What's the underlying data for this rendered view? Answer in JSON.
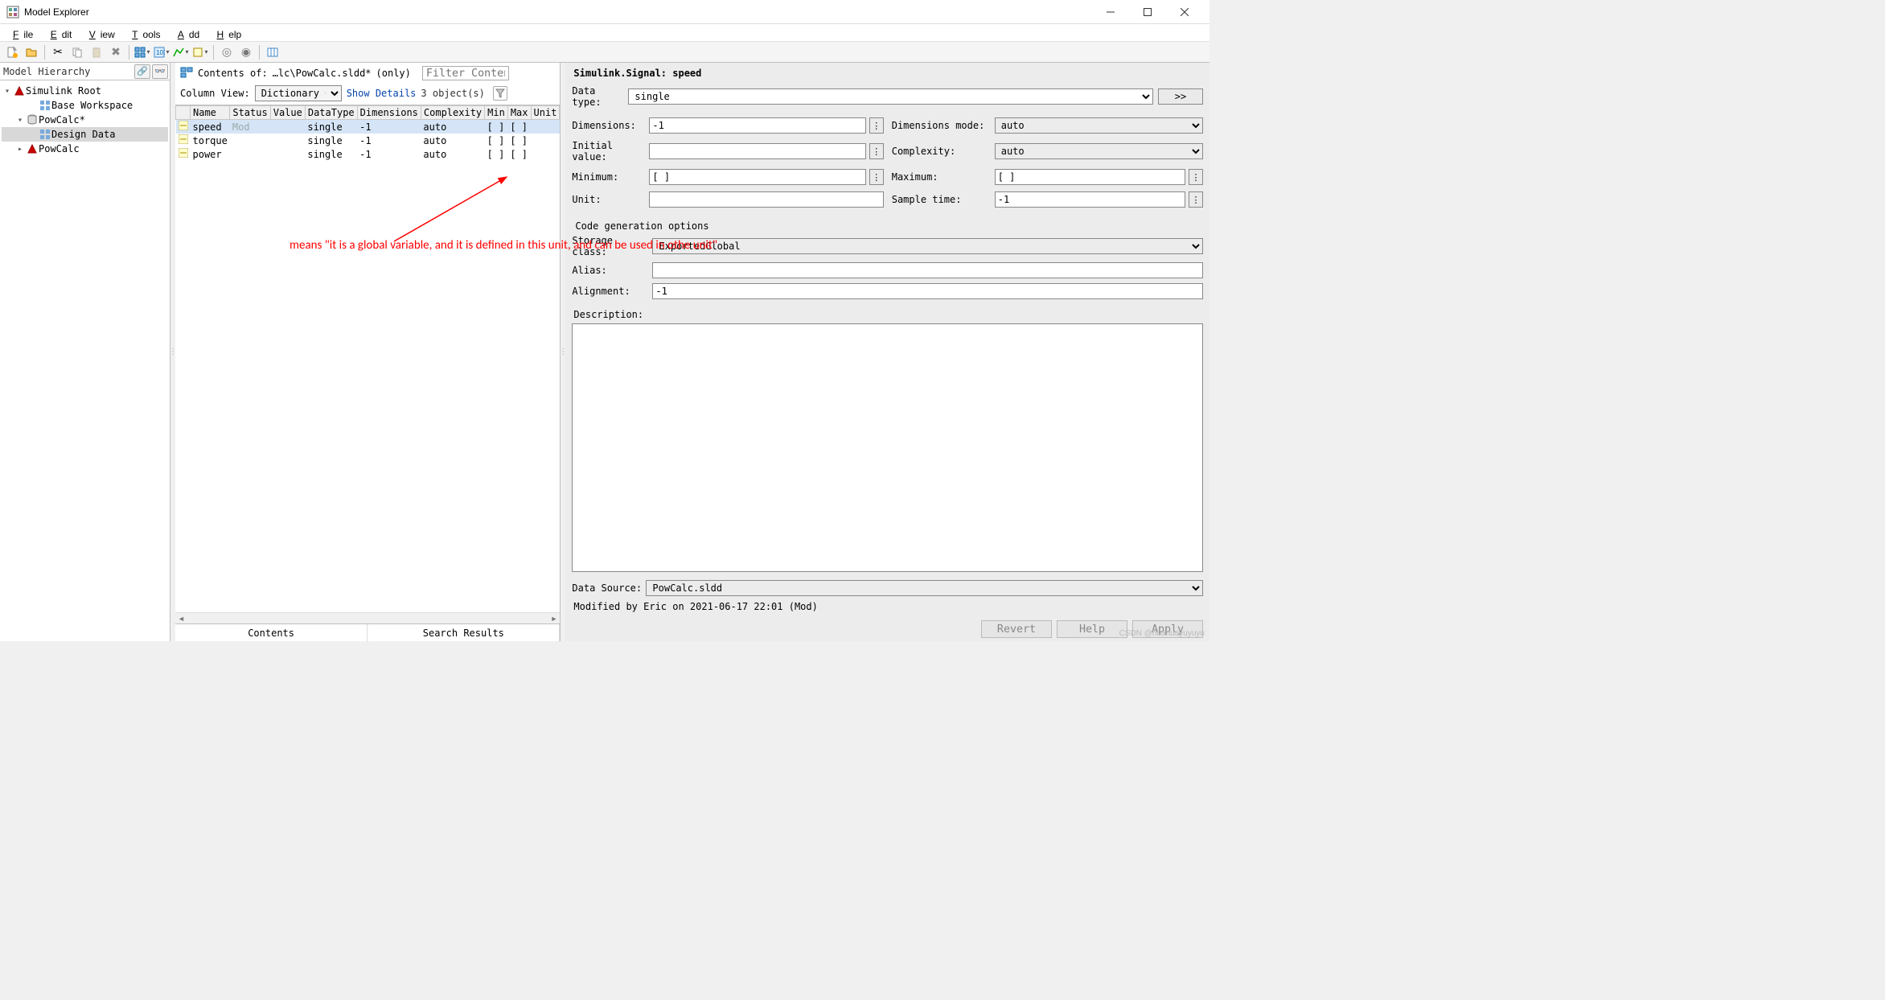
{
  "window": {
    "title": "Model Explorer"
  },
  "menu": {
    "file": "File",
    "edit": "Edit",
    "view": "View",
    "tools": "Tools",
    "add": "Add",
    "help": "Help"
  },
  "hierarchy": {
    "title": "Model Hierarchy",
    "nodes": {
      "root": "Simulink Root",
      "base_ws": "Base Workspace",
      "powcalc_dict": "PowCalc*",
      "design_data": "Design Data",
      "powcalc_model": "PowCalc"
    }
  },
  "contents": {
    "label": "Contents of:",
    "path": "…lc\\PowCalc.sldd*",
    "only": "(only)",
    "filter_placeholder": "Filter Contents",
    "column_view_label": "Column View:",
    "column_view_value": "Dictionary Objects",
    "show_details": "Show Details",
    "count": "3 object(s)",
    "columns": [
      "",
      "Name",
      "Status",
      "Value",
      "DataType",
      "Dimensions",
      "Complexity",
      "Min",
      "Max",
      "Unit"
    ],
    "rows": [
      {
        "name": "speed",
        "status": "Mod",
        "datatype": "single",
        "dims": "-1",
        "complexity": "auto",
        "min": "[ ]",
        "max": "[ ]"
      },
      {
        "name": "torque",
        "status": "",
        "datatype": "single",
        "dims": "-1",
        "complexity": "auto",
        "min": "[ ]",
        "max": "[ ]"
      },
      {
        "name": "power",
        "status": "",
        "datatype": "single",
        "dims": "-1",
        "complexity": "auto",
        "min": "[ ]",
        "max": "[ ]"
      }
    ],
    "tabs": {
      "contents": "Contents",
      "search": "Search Results"
    }
  },
  "props": {
    "header": "Simulink.Signal: speed",
    "datatype_label": "Data type:",
    "datatype_value": "single",
    "go": ">>",
    "dims_label": "Dimensions:",
    "dims_value": "-1",
    "dims_mode_label": "Dimensions mode:",
    "dims_mode_value": "auto",
    "initval_label": "Initial value:",
    "initval_value": "",
    "complexity_label": "Complexity:",
    "complexity_value": "auto",
    "min_label": "Minimum:",
    "min_value": "[ ]",
    "max_label": "Maximum:",
    "max_value": "[ ]",
    "unit_label": "Unit:",
    "unit_value": "",
    "sampletime_label": "Sample time:",
    "sampletime_value": "-1",
    "codegen_title": "Code generation options",
    "storage_label": "Storage class:",
    "storage_value": "ExportedGlobal",
    "alias_label": "Alias:",
    "alias_value": "",
    "alignment_label": "Alignment:",
    "alignment_value": "-1",
    "desc_label": "Description:",
    "source_label": "Data Source:",
    "source_value": "PowCalc.sldd",
    "modified": "Modified by Eric on 2021-06-17 22:01 (Mod)",
    "revert": "Revert",
    "help": "Help",
    "apply": "Apply"
  },
  "annotation": {
    "text": "means \"it is a global variable, and it is defined in this unit, and can be used in othe unit\""
  },
  "watermark": "CSDN @huahuayuyuyu"
}
